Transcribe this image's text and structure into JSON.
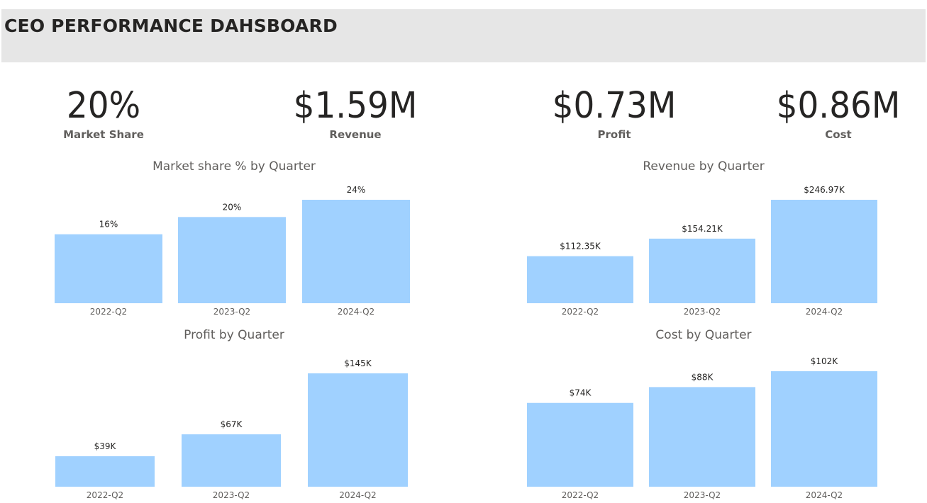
{
  "header": {
    "title": "CEO PERFORMANCE DAHSBOARD"
  },
  "kpis": [
    {
      "value": "20%",
      "label": "Market Share"
    },
    {
      "value": "$1.59M",
      "label": "Revenue"
    },
    {
      "value": "$0.73M",
      "label": "Profit"
    },
    {
      "value": "$0.86M",
      "label": "Cost"
    }
  ],
  "colors": {
    "bar": "#a0d1ff",
    "header_bg": "#e6e6e6"
  },
  "chart_data": [
    {
      "type": "bar",
      "title": "Market share % by Quarter",
      "categories": [
        "2022-Q2",
        "2023-Q2",
        "2024-Q2"
      ],
      "values": [
        16,
        20,
        24
      ],
      "labels": [
        "16%",
        "20%",
        "24%"
      ],
      "ylim": [
        0,
        24
      ],
      "xlabel": "",
      "ylabel": "",
      "grid": false
    },
    {
      "type": "bar",
      "title": "Revenue by Quarter",
      "categories": [
        "2022-Q2",
        "2023-Q2",
        "2024-Q2"
      ],
      "values": [
        112.35,
        154.21,
        246.97
      ],
      "labels": [
        "$112.35K",
        "$154.21K",
        "$246.97K"
      ],
      "ylim": [
        0,
        246.97
      ],
      "xlabel": "",
      "ylabel": "",
      "grid": false
    },
    {
      "type": "bar",
      "title": "Profit by Quarter",
      "categories": [
        "2022-Q2",
        "2023-Q2",
        "2024-Q2"
      ],
      "values": [
        39,
        67,
        145
      ],
      "labels": [
        "$39K",
        "$67K",
        "$145K"
      ],
      "ylim": [
        0,
        145
      ],
      "xlabel": "",
      "ylabel": "",
      "grid": false
    },
    {
      "type": "bar",
      "title": "Cost by Quarter",
      "categories": [
        "2022-Q2",
        "2023-Q2",
        "2024-Q2"
      ],
      "values": [
        74,
        88,
        102
      ],
      "labels": [
        "$74K",
        "$88K",
        "$102K"
      ],
      "ylim": [
        0,
        102
      ],
      "xlabel": "",
      "ylabel": "",
      "grid": false
    }
  ]
}
